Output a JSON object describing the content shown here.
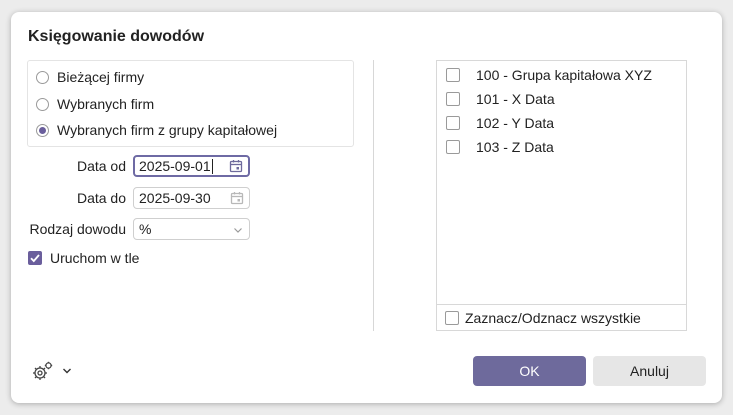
{
  "dialog": {
    "title": "Księgowanie dowodów"
  },
  "scope": {
    "options": [
      {
        "label": "Bieżącej firmy",
        "checked": false
      },
      {
        "label": "Wybranych firm",
        "checked": false
      },
      {
        "label": "Wybranych firm z grupy kapitałowej",
        "checked": true
      }
    ]
  },
  "fields": {
    "date_from_label": "Data od",
    "date_from_value": "2025-09-01",
    "date_to_label": "Data do",
    "date_to_value": "2025-09-30",
    "doc_type_label": "Rodzaj dowodu",
    "doc_type_value": "%"
  },
  "run_background": {
    "label": "Uruchom w tle",
    "checked": true
  },
  "companies": {
    "items": [
      {
        "label": "100 - Grupa kapitałowa XYZ",
        "checked": false
      },
      {
        "label": "101 - X Data",
        "checked": false
      },
      {
        "label": "102 - Y Data",
        "checked": false
      },
      {
        "label": "103 - Z Data",
        "checked": false
      }
    ],
    "select_all_label": "Zaznacz/Odznacz wszystkie"
  },
  "buttons": {
    "ok": "OK",
    "cancel": "Anuluj"
  },
  "icons": {
    "settings": "gear-icon",
    "dropdown": "chevron-down-icon",
    "calendar": "calendar-icon"
  },
  "colors": {
    "accent": "#6e6a9c",
    "cancel_bg": "#e6e6e6"
  }
}
